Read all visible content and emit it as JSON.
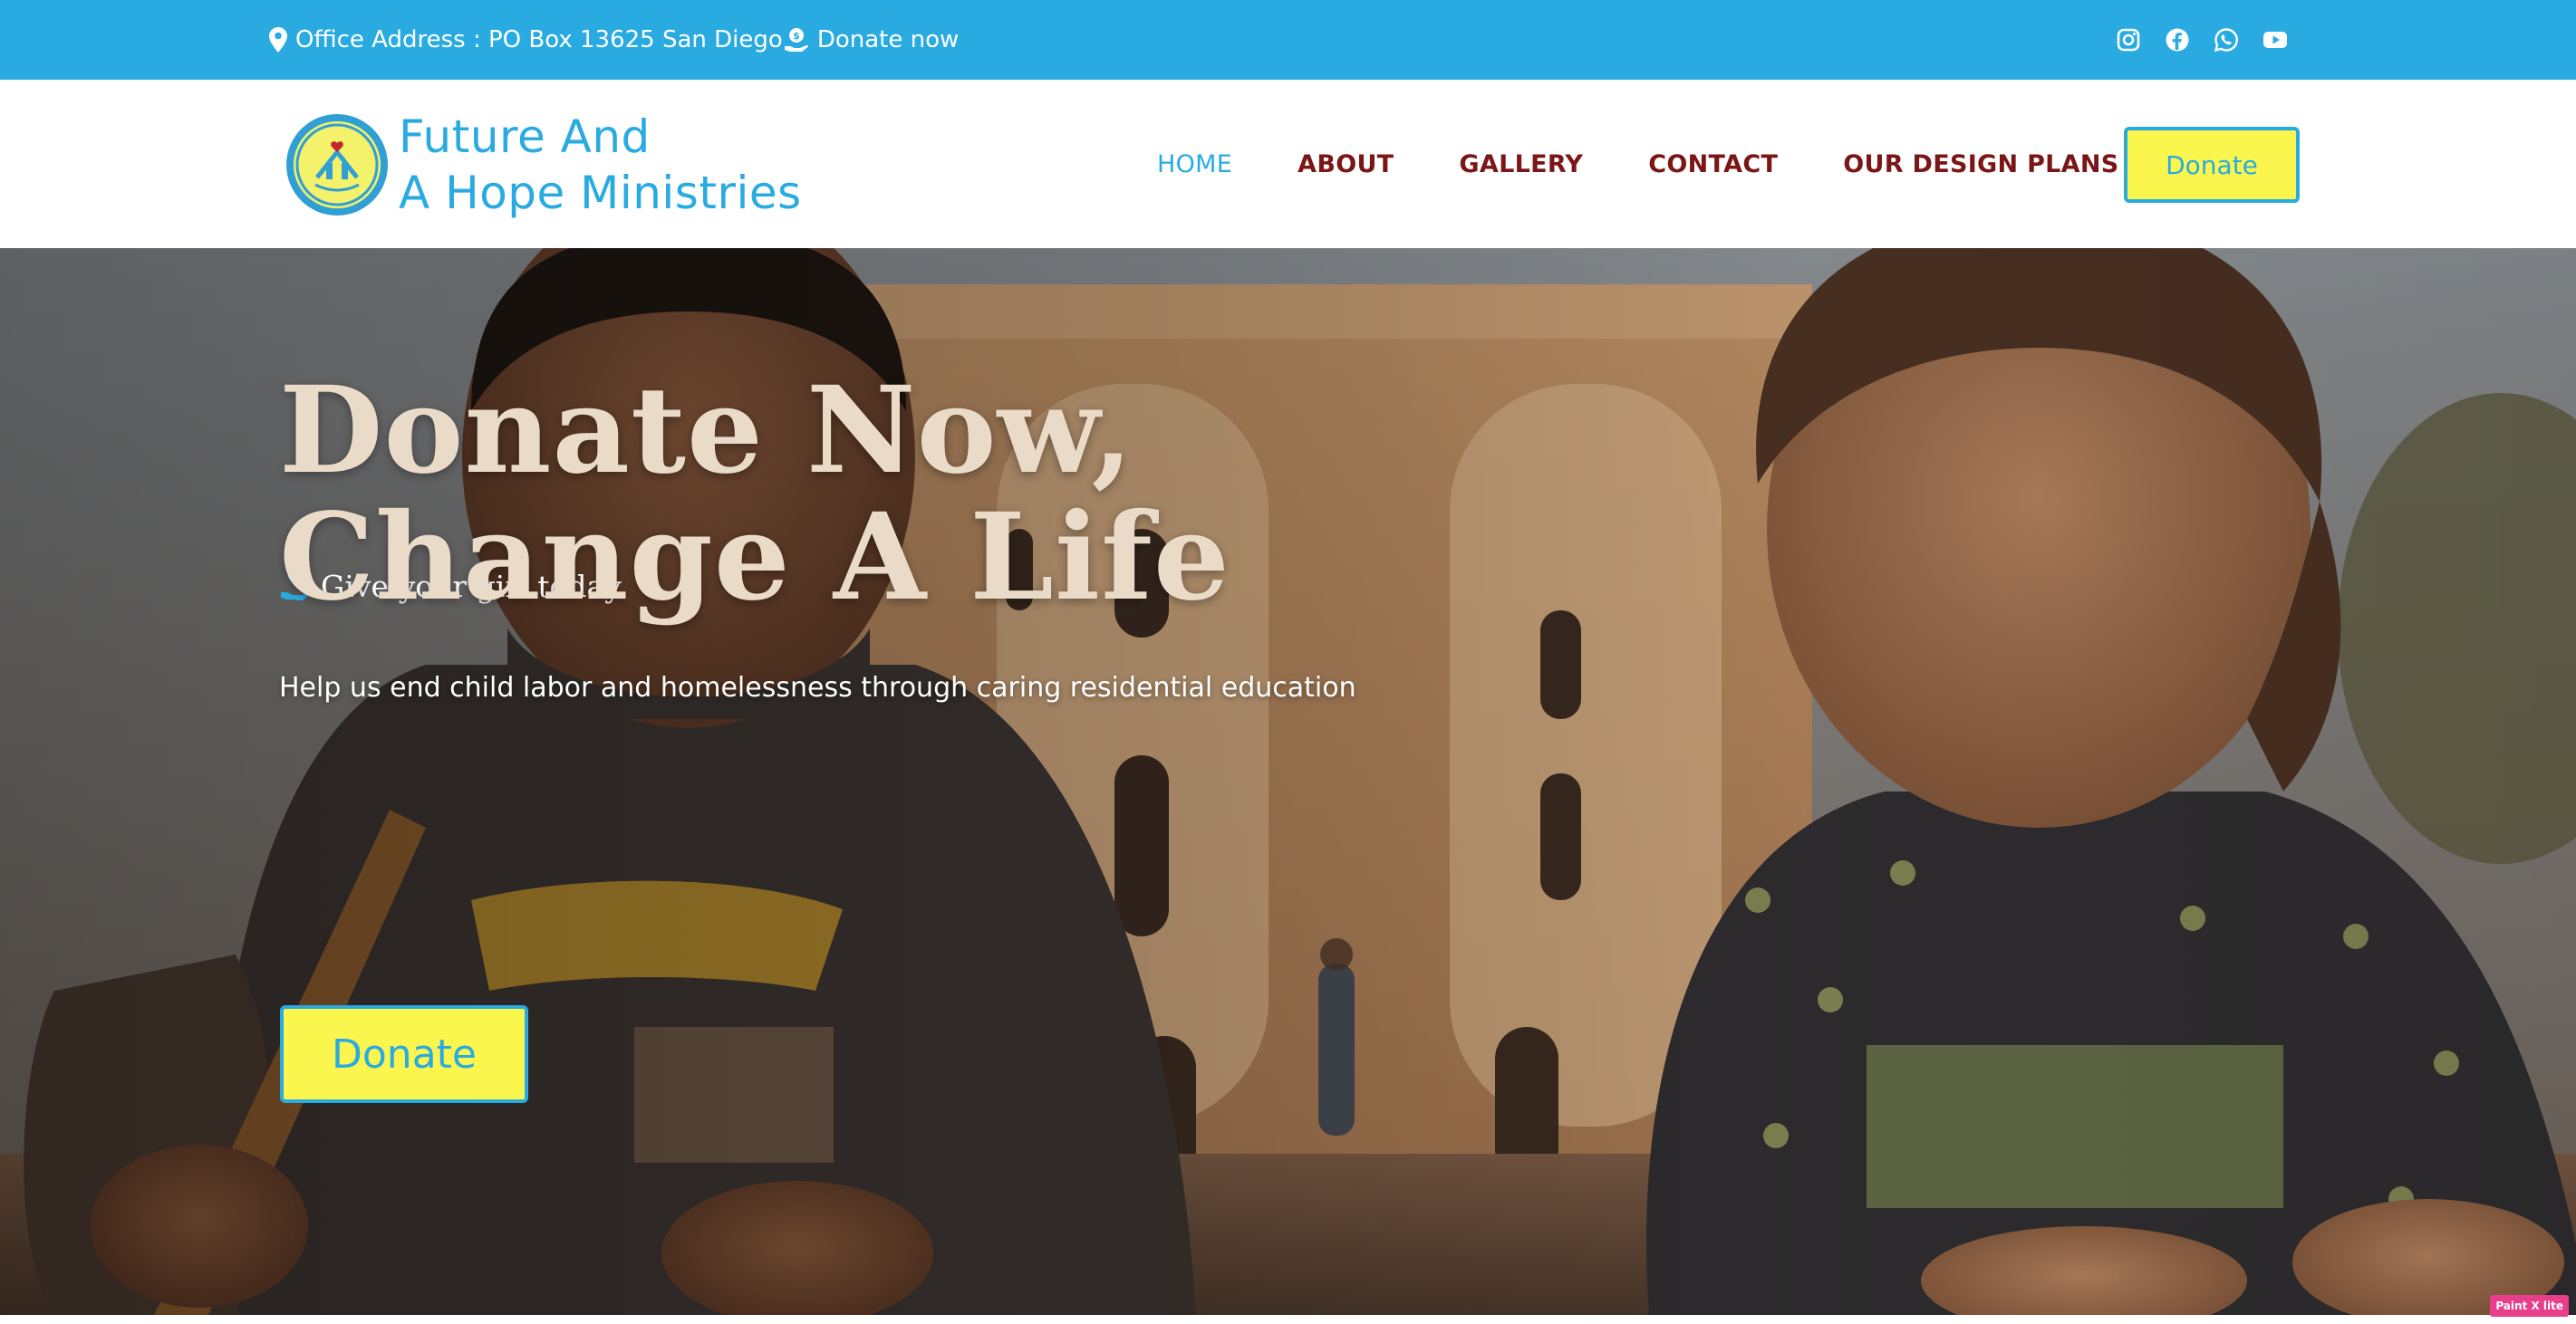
{
  "topbar": {
    "address_icon": "map-pin-icon",
    "address": "Office Address : PO Box 13625 San Diego",
    "donate_icon": "hand-coin-icon",
    "donate_link": "Donate now",
    "social": [
      "instagram-icon",
      "facebook-icon",
      "whatsapp-icon",
      "youtube-icon"
    ],
    "bg_color": "#29abe2"
  },
  "header": {
    "logo_icon": "ministry-logo",
    "brand_line1": "Future And",
    "brand_line2": "A Hope Ministries",
    "nav": [
      {
        "label": "HOME",
        "active": true
      },
      {
        "label": "ABOUT",
        "active": false
      },
      {
        "label": "GALLERY",
        "active": false
      },
      {
        "label": "CONTACT",
        "active": false
      },
      {
        "label": "OUR DESIGN PLANS",
        "active": false
      }
    ],
    "donate_button": "Donate",
    "nav_color": "#7a1616",
    "accent_color": "#29abe2",
    "button_color": "#fbf64d"
  },
  "hero": {
    "eyebrow_icon": "hand-heart-icon",
    "eyebrow": "Give your gift today",
    "title_line1": "Donate Now,",
    "title_line2": "Change A Life",
    "subtitle": "Help us end child labor and homelessness through caring residential education",
    "donate_button": "Donate",
    "title_color": "#eadbc9"
  },
  "badge": "Paint X lite"
}
